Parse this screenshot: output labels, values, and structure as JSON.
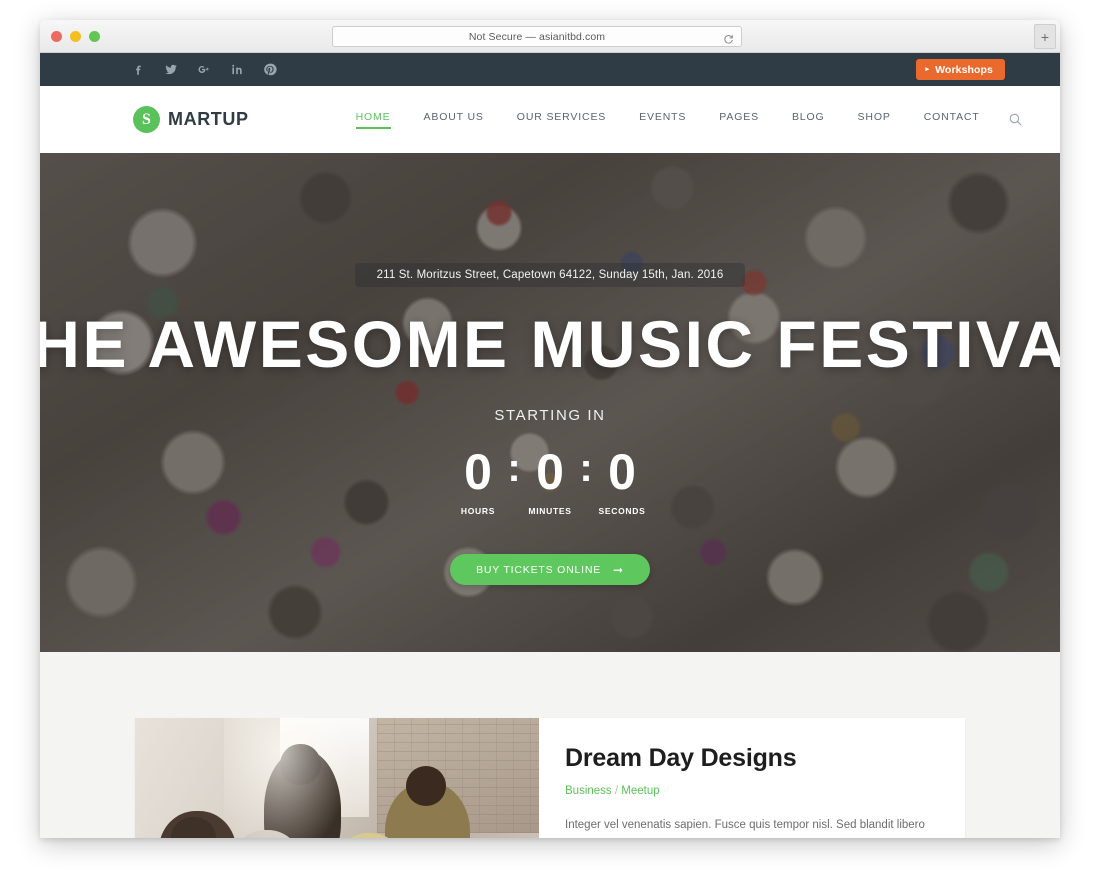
{
  "browser": {
    "url_text": "Not Secure — asianitbd.com",
    "reload_label": "↻",
    "newtab_label": "+",
    "traffic_lights": [
      "close",
      "minimize",
      "zoom"
    ]
  },
  "topbar": {
    "social": [
      {
        "name": "facebook",
        "label": "f"
      },
      {
        "name": "twitter",
        "label": "Twitter"
      },
      {
        "name": "google-plus",
        "label": "g+"
      },
      {
        "name": "linkedin",
        "label": "in"
      },
      {
        "name": "pinterest",
        "label": "P"
      }
    ],
    "cta": {
      "label": "Workshops",
      "arrow": "▸",
      "color": "#ea6a2d"
    }
  },
  "nav": {
    "logo": {
      "mark": "S",
      "text": "MARTUP",
      "mark_color": "#5bc15b"
    },
    "items": [
      {
        "label": "HOME",
        "active": true
      },
      {
        "label": "ABOUT US",
        "active": false
      },
      {
        "label": "OUR SERVICES",
        "active": false
      },
      {
        "label": "EVENTS",
        "active": false
      },
      {
        "label": "PAGES",
        "active": false
      },
      {
        "label": "BLOG",
        "active": false
      },
      {
        "label": "SHOP",
        "active": false
      },
      {
        "label": "CONTACT",
        "active": false
      }
    ],
    "search_icon": "search-icon",
    "accent_color": "#5bc15b"
  },
  "hero": {
    "address": "211 St. Moritzus Street, Capetown 64122, Sunday 15th, Jan. 2016",
    "title": "THE AWESOME MUSIC FESTIVAL",
    "starting_label": "STARTING IN",
    "countdown": {
      "separator": ":",
      "units": [
        {
          "value": "0",
          "label": "HOURS"
        },
        {
          "value": "0",
          "label": "MINUTES"
        },
        {
          "value": "0",
          "label": "SECONDS"
        }
      ]
    },
    "cta": {
      "label": "BUY TICKETS ONLINE",
      "arrow": "➞",
      "color": "#5ec85e"
    }
  },
  "post": {
    "title": "Dream Day Designs",
    "category_primary": "Business",
    "category_separator": "/",
    "category_secondary": "Meetup",
    "excerpt": "Integer vel venenatis sapien. Fusce quis tempor nisl. Sed blandit libero aliquet lorem placerat, vitae interdum est malesuada. Morbi nec sapien erat. Integer purus ante, faucibus"
  }
}
